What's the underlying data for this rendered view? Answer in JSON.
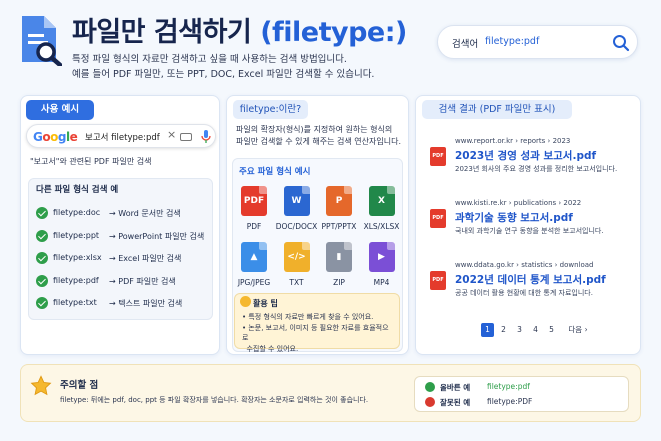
{
  "header": {
    "title_main": "파일만 검색하기",
    "title_accent": "(filetype:)",
    "description_lines": [
      "특정 파일 형식의 자료만 검색하고 싶을 때 사용하는 검색 방법입니다.",
      "예를 들어 PDF 파일만, 또는 PPT, DOC, Excel 파일만 검색할 수 있습니다."
    ],
    "icon": "document-search-icon"
  },
  "top_search": {
    "label": "검색어",
    "query": "filetype:pdf",
    "icon": "search-icon"
  },
  "usage_panel": {
    "heading": "사용 예시",
    "google_logo": [
      "G",
      "o",
      "o",
      "g",
      "l",
      "e"
    ],
    "google_colors": [
      "#4285f4",
      "#ea4335",
      "#fbbc05",
      "#4285f4",
      "#34a853",
      "#ea4335"
    ],
    "search_query": "보고서 filetype:pdf",
    "clear_symbol": "×",
    "note": "\"보고서\"와 관련된 PDF 파일만 검색",
    "examples_heading": "다른 파일 형식 검색 예",
    "examples": [
      {
        "key": "filetype:doc",
        "value": "→ Word 문서만 검색"
      },
      {
        "key": "filetype:ppt",
        "value": "→ PowerPoint 파일만 검색"
      },
      {
        "key": "filetype:xlsx",
        "value": "→ Excel 파일만 검색"
      },
      {
        "key": "filetype:pdf",
        "value": "→ PDF 파일만 검색"
      },
      {
        "key": "filetype:txt",
        "value": "→ 텍스트 파일만 검색"
      }
    ]
  },
  "about_panel": {
    "heading": "filetype:이란?",
    "description_lines": [
      "파일의 확장자(형식)를 지정하여 원하는 형식의",
      "파일만 검색할 수 있게 해주는 검색 연산자입니다."
    ],
    "types_heading": "주요 파일 형식 예시",
    "types": [
      {
        "label": "PDF",
        "glyph": "PDF",
        "color": "#e43b2c",
        "icon": "pdf-file-icon"
      },
      {
        "label": "DOC/DOCX",
        "glyph": "W",
        "color": "#2b67d1",
        "icon": "word-file-icon"
      },
      {
        "label": "PPT/PPTX",
        "glyph": "P",
        "color": "#e5682b",
        "icon": "powerpoint-file-icon"
      },
      {
        "label": "XLS/XLSX",
        "glyph": "X",
        "color": "#21884a",
        "icon": "excel-file-icon"
      },
      {
        "label": "JPG/JPEG",
        "glyph": "▲",
        "color": "#3b8ee8",
        "icon": "image-file-icon"
      },
      {
        "label": "TXT",
        "glyph": "</>",
        "color": "#f0b02b",
        "icon": "text-file-icon"
      },
      {
        "label": "ZIP",
        "glyph": "▮",
        "color": "#8a93a3",
        "icon": "zip-file-icon"
      },
      {
        "label": "MP4",
        "glyph": "▶",
        "color": "#7b4fd6",
        "icon": "video-file-icon"
      }
    ],
    "tip_heading": "활용 팁",
    "tips": [
      "• 특정 형식의 자료만 빠르게 찾을 수 있어요.",
      "• 논문, 보고서, 이미지 등 필요한 자료를 효율적으로",
      "  수집할 수 있어요."
    ]
  },
  "results_panel": {
    "heading": "검색 결과 (PDF 파일만 표시)",
    "results": [
      {
        "url": "www.report.or.kr › reports › 2023",
        "title": "2023년 경영 성과 보고서.pdf",
        "desc": "2023년 회사의 주요 경영 성과를 정리한 보고서입니다."
      },
      {
        "url": "www.kisti.re.kr › publications › 2022",
        "title": "과학기술 동향 보고서.pdf",
        "desc": "국내외 과학기술 연구 동향을 분석한 보고서입니다."
      },
      {
        "url": "www.ddata.go.kr › statistics › download",
        "title": "2022년 데이터 통계 보고서.pdf",
        "desc": "공공 데이터 활용 현황에 대한 통계 자료입니다."
      }
    ],
    "pdf_glyph": "PDF",
    "pages": [
      "1",
      "2",
      "3",
      "4",
      "5"
    ],
    "next_label": "다음 ›"
  },
  "caution": {
    "heading": "주의할 점",
    "text": "filetype: 뒤에는 pdf, doc, ppt 등 파일 확장자를 넣습니다. 확장자는 소문자로 입력하는 것이 좋습니다.",
    "correct_label": "올바른 예",
    "correct_value": "filetype:pdf",
    "wrong_label": "잘못된 예",
    "wrong_value": "filetype:PDF",
    "colors": {
      "correct": "#2e9e4a",
      "wrong": "#d93a2f"
    }
  }
}
